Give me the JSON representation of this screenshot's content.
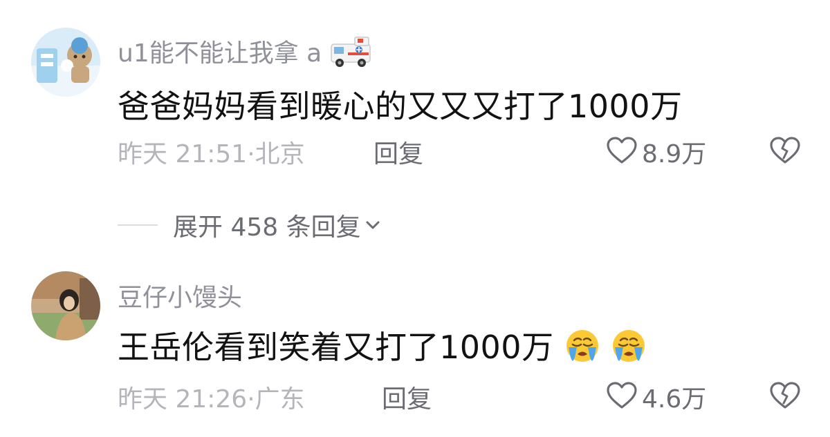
{
  "comments": [
    {
      "username": "u1能不能让我拿 a",
      "username_emoji": "ambulance-icon",
      "content": "爸爸妈妈看到暖心的又又又打了1000万",
      "time_location": "昨天 21:51·北京",
      "reply_label": "回复",
      "likes": "8.9万"
    },
    {
      "username": "豆仔小馒头",
      "content": "王岳伦看到笑着又打了1000万",
      "content_emojis": [
        "crying-face-icon",
        "crying-face-icon"
      ],
      "time_location": "昨天 21:26·广东",
      "reply_label": "回复",
      "likes": "4.6万"
    }
  ],
  "expand_replies": "展开 458 条回复",
  "colors": {
    "text_primary": "#121212",
    "text_secondary": "#8f9099",
    "text_meta": "#b4b5bb",
    "action": "#6b6c73"
  }
}
